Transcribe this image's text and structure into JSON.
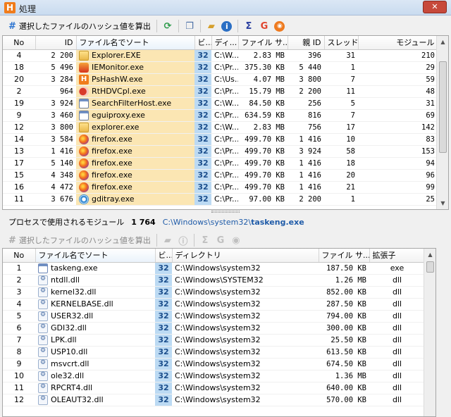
{
  "window": {
    "title": "処理",
    "app_icon": "H",
    "close_label": "✕"
  },
  "top_toolbar": {
    "hash_button_label": "選択したファイルのハッシュ値を算出",
    "icons": [
      "refresh-icon",
      "copy-icon",
      "open-folder-icon",
      "info-icon",
      "sigma-icon",
      "google-icon",
      "virustotal-icon"
    ]
  },
  "process_table": {
    "columns": [
      "No",
      "ID",
      "ファイル名でソート",
      "ビ...",
      "ディ...",
      "ファイル サ...",
      "親 ID",
      "スレッド",
      "モジュール"
    ],
    "rows": [
      {
        "no": "4",
        "id": "2 200",
        "name": "Explorer.EXE",
        "icon": "folder-icon",
        "bit": "32",
        "dir": "C:\\W...",
        "size": "2.83  MB",
        "parent": "396",
        "threads": "31",
        "modules": "210"
      },
      {
        "no": "18",
        "id": "5 496",
        "name": "IEMonitor.exe",
        "icon": "monitor-icon",
        "bit": "32",
        "dir": "C:\\Pr...",
        "size": "375.30  KB",
        "parent": "5 440",
        "threads": "1",
        "modules": "29"
      },
      {
        "no": "20",
        "id": "3 284",
        "name": "PsHashW.exe",
        "icon": "pshash-icon",
        "bit": "32",
        "dir": "C:\\Us...",
        "size": "4.07  MB",
        "parent": "3 800",
        "threads": "7",
        "modules": "59"
      },
      {
        "no": "2",
        "id": "964",
        "name": "RtHDVCpl.exe",
        "icon": "speaker-icon",
        "bit": "32",
        "dir": "C:\\Pr...",
        "size": "15.79  MB",
        "parent": "2 200",
        "threads": "11",
        "modules": "48"
      },
      {
        "no": "19",
        "id": "3 924",
        "name": "SearchFilterHost.exe",
        "icon": "window-icon",
        "bit": "32",
        "dir": "C:\\W...",
        "size": "84.50  KB",
        "parent": "256",
        "threads": "5",
        "modules": "31"
      },
      {
        "no": "9",
        "id": "3 460",
        "name": "eguiproxy.exe",
        "icon": "window-icon",
        "bit": "32",
        "dir": "C:\\Pr...",
        "size": "634.59  KB",
        "parent": "816",
        "threads": "7",
        "modules": "69"
      },
      {
        "no": "12",
        "id": "3 800",
        "name": "explorer.exe",
        "icon": "folder-icon",
        "bit": "32",
        "dir": "C:\\W...",
        "size": "2.83  MB",
        "parent": "756",
        "threads": "17",
        "modules": "142"
      },
      {
        "no": "14",
        "id": "3 584",
        "name": "firefox.exe",
        "icon": "firefox-icon",
        "bit": "32",
        "dir": "C:\\Pr...",
        "size": "499.70  KB",
        "parent": "1 416",
        "threads": "10",
        "modules": "83"
      },
      {
        "no": "13",
        "id": "1 416",
        "name": "firefox.exe",
        "icon": "firefox-icon",
        "bit": "32",
        "dir": "C:\\Pr...",
        "size": "499.70  KB",
        "parent": "3 924",
        "threads": "58",
        "modules": "153"
      },
      {
        "no": "17",
        "id": "5 140",
        "name": "firefox.exe",
        "icon": "firefox-icon",
        "bit": "32",
        "dir": "C:\\Pr...",
        "size": "499.70  KB",
        "parent": "1 416",
        "threads": "18",
        "modules": "94"
      },
      {
        "no": "15",
        "id": "4 348",
        "name": "firefox.exe",
        "icon": "firefox-icon",
        "bit": "32",
        "dir": "C:\\Pr...",
        "size": "499.70  KB",
        "parent": "1 416",
        "threads": "20",
        "modules": "96"
      },
      {
        "no": "16",
        "id": "4 472",
        "name": "firefox.exe",
        "icon": "firefox-icon",
        "bit": "32",
        "dir": "C:\\Pr...",
        "size": "499.70  KB",
        "parent": "1 416",
        "threads": "21",
        "modules": "99"
      },
      {
        "no": "11",
        "id": "3 676",
        "name": "gditray.exe",
        "icon": "gditray-icon",
        "bit": "32",
        "dir": "C:\\Pr...",
        "size": "97.00  KB",
        "parent": "2 200",
        "threads": "1",
        "modules": "25"
      }
    ]
  },
  "status_bar": {
    "label": "プロセスで使用されるモジュール",
    "count": "1 764",
    "path_prefix": "C:\\Windows\\system32\\",
    "path_file": "taskeng.exe"
  },
  "bottom_toolbar": {
    "hash_button_label": "選択したファイルのハッシュ値を算出",
    "icons": [
      "open-folder-icon",
      "info-icon",
      "sigma-icon",
      "google-icon",
      "virustotal-icon"
    ]
  },
  "module_table": {
    "columns": [
      "No",
      "ファイル名でソート",
      "ビ...",
      "ディレクトリ",
      "ファイル サ...",
      "拡張子"
    ],
    "rows": [
      {
        "no": "1",
        "name": "taskeng.exe",
        "icon": "exe-icon",
        "bit": "32",
        "dir": "C:\\Windows\\system32",
        "size": "187.50  KB",
        "ext": "exe"
      },
      {
        "no": "2",
        "name": "ntdll.dll",
        "icon": "dll-icon",
        "bit": "32",
        "dir": "C:\\Windows\\SYSTEM32",
        "size": "1.26  MB",
        "ext": "dll"
      },
      {
        "no": "3",
        "name": "kernel32.dll",
        "icon": "dll-icon",
        "bit": "32",
        "dir": "C:\\Windows\\system32",
        "size": "852.00  KB",
        "ext": "dll"
      },
      {
        "no": "4",
        "name": "KERNELBASE.dll",
        "icon": "dll-icon",
        "bit": "32",
        "dir": "C:\\Windows\\system32",
        "size": "287.50  KB",
        "ext": "dll"
      },
      {
        "no": "5",
        "name": "USER32.dll",
        "icon": "dll-icon",
        "bit": "32",
        "dir": "C:\\Windows\\system32",
        "size": "794.00  KB",
        "ext": "dll"
      },
      {
        "no": "6",
        "name": "GDI32.dll",
        "icon": "dll-icon",
        "bit": "32",
        "dir": "C:\\Windows\\system32",
        "size": "300.00  KB",
        "ext": "dll"
      },
      {
        "no": "7",
        "name": "LPK.dll",
        "icon": "dll-icon",
        "bit": "32",
        "dir": "C:\\Windows\\system32",
        "size": "25.50  KB",
        "ext": "dll"
      },
      {
        "no": "8",
        "name": "USP10.dll",
        "icon": "dll-icon",
        "bit": "32",
        "dir": "C:\\Windows\\system32",
        "size": "613.50  KB",
        "ext": "dll"
      },
      {
        "no": "9",
        "name": "msvcrt.dll",
        "icon": "dll-icon",
        "bit": "32",
        "dir": "C:\\Windows\\system32",
        "size": "674.50  KB",
        "ext": "dll"
      },
      {
        "no": "10",
        "name": "ole32.dll",
        "icon": "dll-icon",
        "bit": "32",
        "dir": "C:\\Windows\\system32",
        "size": "1.36  MB",
        "ext": "dll"
      },
      {
        "no": "11",
        "name": "RPCRT4.dll",
        "icon": "dll-icon",
        "bit": "32",
        "dir": "C:\\Windows\\system32",
        "size": "640.00  KB",
        "ext": "dll"
      },
      {
        "no": "12",
        "name": "OLEAUT32.dll",
        "icon": "dll-icon",
        "bit": "32",
        "dir": "C:\\Windows\\system32",
        "size": "570.00  KB",
        "ext": "dll"
      }
    ]
  }
}
